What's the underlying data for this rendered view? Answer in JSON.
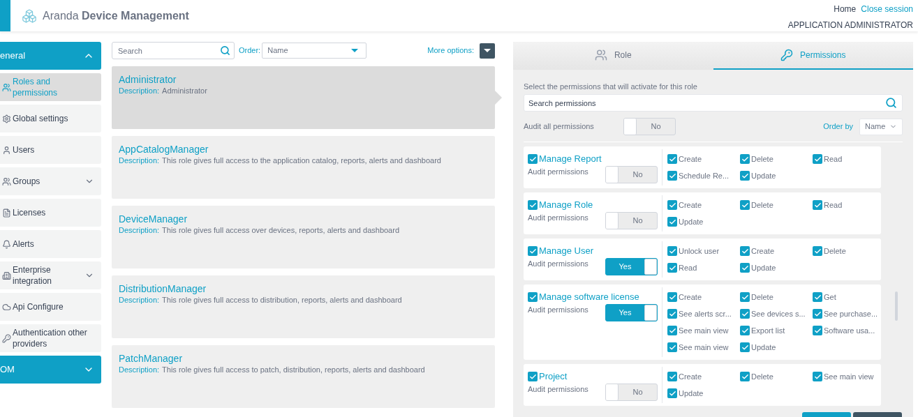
{
  "header": {
    "brand": "Aranda **Device Management**",
    "links": [
      {
        "label": "Home",
        "kind": "plain"
      },
      {
        "label": "Close session",
        "kind": "link"
      }
    ],
    "user": "APPLICATION ADMINISTRATOR"
  },
  "sidebar": {
    "items": [
      {
        "kind": "section",
        "label": "eneral",
        "expanded": true
      },
      {
        "kind": "item",
        "label": "Roles and permissions",
        "selected": true
      },
      {
        "kind": "item",
        "label": "Global settings",
        "selected": false
      },
      {
        "kind": "item",
        "label": "Users",
        "selected": false
      },
      {
        "kind": "item",
        "label": "Groups",
        "selected": false,
        "expanded": false
      },
      {
        "kind": "item",
        "label": "Licenses",
        "selected": false
      },
      {
        "kind": "item",
        "label": "Alerts",
        "selected": false
      },
      {
        "kind": "item",
        "label": "Enterprise integration",
        "selected": false,
        "expanded": false
      },
      {
        "kind": "item",
        "label": "Api Configure",
        "selected": false
      },
      {
        "kind": "item",
        "label": "Authentication other providers",
        "selected": false
      },
      {
        "kind": "section",
        "label": "OM",
        "expanded": false
      }
    ]
  },
  "roles": {
    "search": {
      "placeholder": "Search"
    },
    "order_label": "Order:",
    "order_value": "Name",
    "more_options": "More options:",
    "items": [
      {
        "name": "Administrator",
        "description_label": "Description:",
        "description": "Administrator",
        "selected": true
      },
      {
        "name": "AppCatalogManager",
        "description_label": "Description:",
        "description": "This role gives full access to the application catalog, reports, alerts and dashboard",
        "selected": false
      },
      {
        "name": "DeviceManager",
        "description_label": "Description:",
        "description": "This role gives full access over devices, reports, alerts and dashboard",
        "selected": false
      },
      {
        "name": "DistributionManager",
        "description_label": "Description:",
        "description": "This role gives full access to distribution, reports, alerts and dashboard",
        "selected": false
      },
      {
        "name": "PatchManager",
        "description_label": "Description:",
        "description": "This role gives full access to patch, distribution, reports, alerts and dashboard",
        "selected": false
      }
    ]
  },
  "panel": {
    "tabs": [
      {
        "label": "Role",
        "selected": false
      },
      {
        "label": "Permissions",
        "selected": true
      }
    ],
    "hint": "Select the permissions that will activate for this role",
    "search": {
      "placeholder": "Search permissions"
    },
    "audit_all": {
      "label": "Audit all permissions",
      "on": false,
      "state": "No"
    },
    "order_by": "Order by",
    "order_value": "Name",
    "groups": [
      {
        "name": "Manage Report",
        "checked": true,
        "audit_label": "Audit permissions",
        "audit_on": false,
        "audit_state": "No",
        "permissions": [
          {
            "label": "Create",
            "checked": true
          },
          {
            "label": "Delete",
            "checked": true
          },
          {
            "label": "Read",
            "checked": true
          },
          {
            "label": "Schedule Re...",
            "checked": true
          },
          {
            "label": "Update",
            "checked": true
          }
        ]
      },
      {
        "name": "Manage Role",
        "checked": true,
        "audit_label": "Audit permissions",
        "audit_on": false,
        "audit_state": "No",
        "permissions": [
          {
            "label": "Create",
            "checked": true
          },
          {
            "label": "Delete",
            "checked": true
          },
          {
            "label": "Read",
            "checked": true
          },
          {
            "label": "Update",
            "checked": true
          }
        ]
      },
      {
        "name": "Manage User",
        "checked": true,
        "audit_label": "Audit permissions",
        "audit_on": true,
        "audit_state": "Yes",
        "permissions": [
          {
            "label": "Unlock user",
            "checked": true
          },
          {
            "label": "Create",
            "checked": true
          },
          {
            "label": "Delete",
            "checked": true
          },
          {
            "label": "Read",
            "checked": true
          },
          {
            "label": "Update",
            "checked": true
          }
        ]
      },
      {
        "name": "Manage software license",
        "checked": true,
        "audit_label": "Audit permissions",
        "audit_on": true,
        "audit_state": "Yes",
        "permissions": [
          {
            "label": "Create",
            "checked": true
          },
          {
            "label": "Delete",
            "checked": true
          },
          {
            "label": "Get",
            "checked": true
          },
          {
            "label": "See alerts scr...",
            "checked": true
          },
          {
            "label": "See devices s...",
            "checked": true
          },
          {
            "label": "See purchase...",
            "checked": true
          },
          {
            "label": "See main view",
            "checked": true
          },
          {
            "label": "Export list",
            "checked": true
          },
          {
            "label": "Software usa...",
            "checked": true
          },
          {
            "label": "See main view",
            "checked": true
          },
          {
            "label": "Update",
            "checked": true
          }
        ]
      },
      {
        "name": "Project",
        "checked": true,
        "audit_label": "Audit permissions",
        "audit_on": false,
        "audit_state": "No",
        "permissions": [
          {
            "label": "Create",
            "checked": true
          },
          {
            "label": "Delete",
            "checked": true
          },
          {
            "label": "See main view",
            "checked": true
          },
          {
            "label": "Update",
            "checked": true
          }
        ]
      }
    ],
    "buttons": [
      {
        "kind": "primary"
      },
      {
        "kind": "secondary"
      }
    ]
  }
}
